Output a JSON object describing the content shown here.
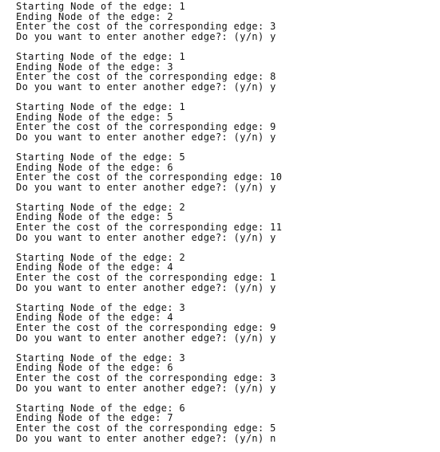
{
  "console": {
    "blocks": [
      {
        "start_line": "Starting Node of the edge: 1",
        "end_line": "Ending Node of the edge: 2",
        "cost_line": "Enter the cost of the corresponding edge: 3",
        "continue_line": "Do you want to enter another edge?: (y/n) y"
      },
      {
        "start_line": "Starting Node of the edge: 1",
        "end_line": "Ending Node of the edge: 3",
        "cost_line": "Enter the cost of the corresponding edge: 8",
        "continue_line": "Do you want to enter another edge?: (y/n) y"
      },
      {
        "start_line": "Starting Node of the edge: 1",
        "end_line": "Ending Node of the edge: 5",
        "cost_line": "Enter the cost of the corresponding edge: 9",
        "continue_line": "Do you want to enter another edge?: (y/n) y"
      },
      {
        "start_line": "Starting Node of the edge: 5",
        "end_line": "Ending Node of the edge: 6",
        "cost_line": "Enter the cost of the corresponding edge: 10",
        "continue_line": "Do you want to enter another edge?: (y/n) y"
      },
      {
        "start_line": "Starting Node of the edge: 2",
        "end_line": "Ending Node of the edge: 5",
        "cost_line": "Enter the cost of the corresponding edge: 11",
        "continue_line": "Do you want to enter another edge?: (y/n) y"
      },
      {
        "start_line": "Starting Node of the edge: 2",
        "end_line": "Ending Node of the edge: 4",
        "cost_line": "Enter the cost of the corresponding edge: 1",
        "continue_line": "Do you want to enter another edge?: (y/n) y"
      },
      {
        "start_line": "Starting Node of the edge: 3",
        "end_line": "Ending Node of the edge: 4",
        "cost_line": "Enter the cost of the corresponding edge: 9",
        "continue_line": "Do you want to enter another edge?: (y/n) y"
      },
      {
        "start_line": "Starting Node of the edge: 3",
        "end_line": "Ending Node of the edge: 6",
        "cost_line": "Enter the cost of the corresponding edge: 3",
        "continue_line": "Do you want to enter another edge?: (y/n) y"
      },
      {
        "start_line": "Starting Node of the edge: 6",
        "end_line": "Ending Node of the edge: 7",
        "cost_line": "Enter the cost of the corresponding edge: 5",
        "continue_line": "Do you want to enter another edge?: (y/n) n"
      }
    ]
  }
}
